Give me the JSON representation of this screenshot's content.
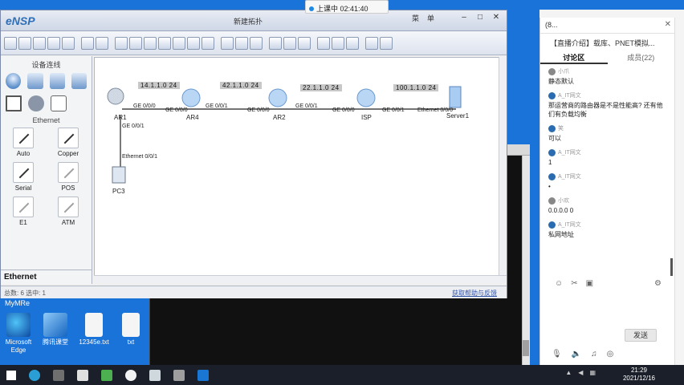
{
  "recording": {
    "label": "上课中 02:41:40"
  },
  "ensp": {
    "logo": "eNSP",
    "title": "新建拓扑",
    "menu": [
      "菜",
      "单"
    ],
    "panel_header": "设备连线",
    "ethernet_header": "Ethernet",
    "ethernet_footer": "Ethernet",
    "cables": [
      {
        "label": "Auto"
      },
      {
        "label": "Copper"
      },
      {
        "label": "Serial"
      },
      {
        "label": "POS"
      },
      {
        "label": "E1"
      },
      {
        "label": "ATM"
      }
    ],
    "status_left": "总数: 6  选中: 1",
    "status_right": "获取帮助与反馈",
    "nodes": {
      "ar1": "AR1",
      "ar4": "AR4",
      "ar2": "AR2",
      "isp": "ISP",
      "server": "Server1",
      "pc": "PC3"
    },
    "networks": {
      "n1": "14.1.1.0 24",
      "n2": "42.1.1.0 24",
      "n3": "22.1.1.0 24",
      "n4": "100.1.1.0 24"
    },
    "ports": {
      "ar1_e": "GE 0/0/0",
      "ar4_w": "GE 0/0/0",
      "ar4_e": "GE 0/0/1",
      "ar2_w": "GE 0/0/0",
      "ar2_e": "GE 0/0/1",
      "isp_w": "GE 0/0/0",
      "isp_e": "GE 0/0/1",
      "srv_w": "Ethernet 0/0/0",
      "ar1_s": "GE 0/0/1",
      "pc_n": "Ethernet 0/0/1"
    }
  },
  "desktop": {
    "top_label": "MyMRe",
    "icons": [
      {
        "label": "Microsoft Edge"
      },
      {
        "label": "腾讯课堂"
      },
      {
        "label": "12345e.txt"
      },
      {
        "label": "txt"
      }
    ]
  },
  "chat": {
    "header": "(8...",
    "subtitle": "【直播介绍】载库、PNET模拟...",
    "tabs": [
      {
        "label": "讨论区"
      },
      {
        "label": "成员(22)"
      }
    ],
    "messages": [
      {
        "who": "小爪",
        "text": "静态默认"
      },
      {
        "who": "A_IT网文",
        "text": "那运营商的路由器是不是性能高? 还有他们有负载均衡"
      },
      {
        "who": "笑",
        "text": "可以"
      },
      {
        "who": "A_IT网文",
        "text": "1"
      },
      {
        "who": "A_IT网文",
        "text": "•"
      },
      {
        "who": "小欢",
        "text": "0.0.0.0 0"
      },
      {
        "who": "A_IT网文",
        "text": "私网地址"
      }
    ],
    "send_label": "发送"
  },
  "clock": {
    "time": "21:29",
    "date": "2021/12/16"
  }
}
